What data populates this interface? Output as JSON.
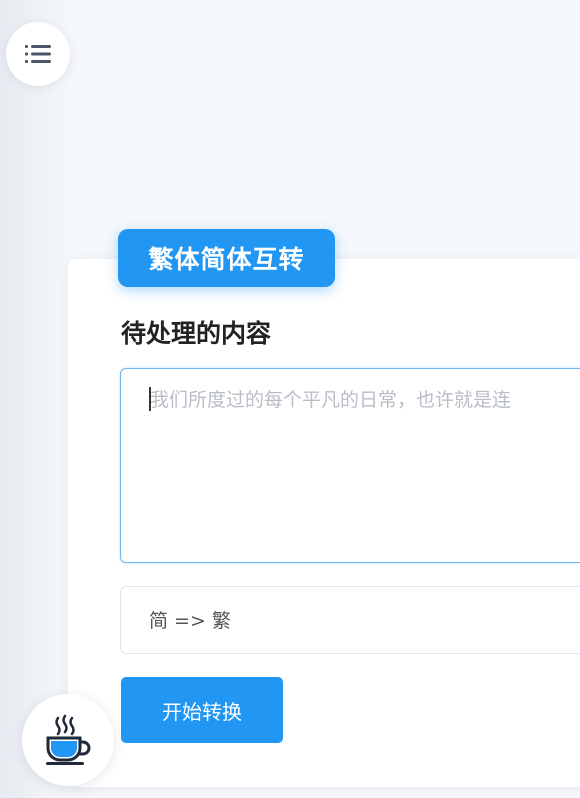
{
  "card": {
    "title": "繁体简体互转",
    "input_label": "待处理的内容",
    "input_placeholder": "我们所度过的每个平凡的日常，也许就是连",
    "mode_select_value": "简 => 繁",
    "convert_button_label": "开始转换"
  },
  "icons": {
    "menu": "menu-icon",
    "coffee": "coffee-cup-icon"
  },
  "colors": {
    "accent": "#2196f3",
    "background": "#f4f7fb",
    "card": "#ffffff"
  }
}
